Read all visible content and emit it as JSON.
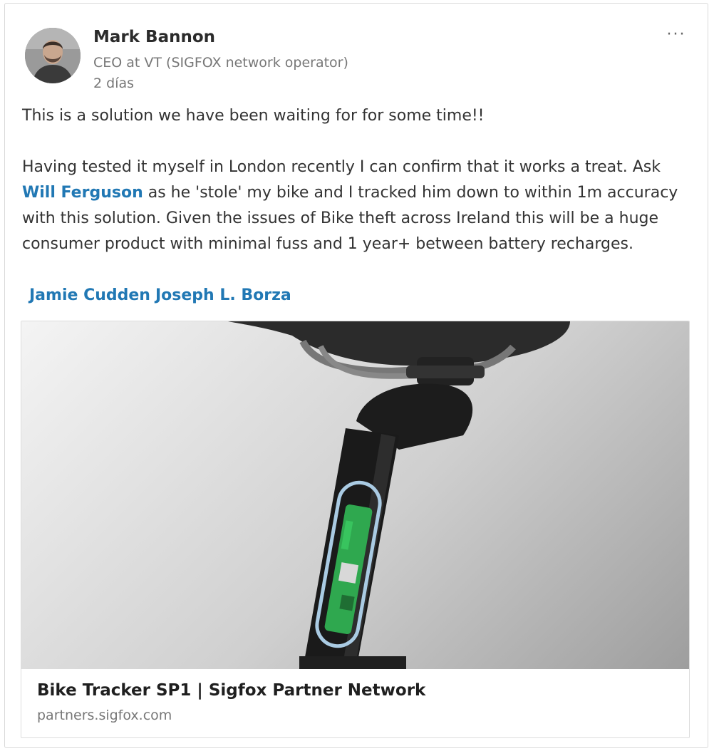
{
  "post": {
    "author": {
      "name": "Mark Bannon",
      "headline": "CEO at VT (SIGFOX network operator)",
      "time": "2 días"
    },
    "more_label": "···",
    "body": {
      "line1": "This is a solution we have been waiting for for some time!!",
      "p2_before": "Having tested it myself in London recently I can confirm that it works a treat. Ask ",
      "mention": "Will Ferguson",
      "p2_after": " as he 'stole' my bike and I tracked him down to within 1m accuracy with this solution. Given the issues of Bike theft across Ireland this will be a huge consumer product with minimal fuss and 1 year+ between battery recharges."
    },
    "tags": [
      "Jamie Cudden",
      "Joseph L. Borza"
    ],
    "link_preview": {
      "title": "Bike Tracker SP1 | Sigfox Partner Network",
      "domain": "partners.sigfox.com"
    }
  },
  "colors": {
    "link": "#2178b4",
    "tracker_board": "#2fa84f",
    "highlight_outline": "#aacbe3"
  },
  "icons": {
    "more": "more-options-icon"
  }
}
